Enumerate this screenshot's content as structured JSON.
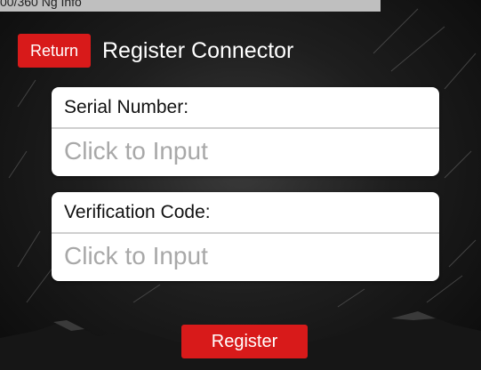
{
  "status_bar": {
    "text": "00/360 Ng Info"
  },
  "header": {
    "return_label": "Return",
    "title": "Register Connector"
  },
  "form": {
    "serial": {
      "label": "Serial Number:",
      "placeholder": "Click to Input",
      "value": ""
    },
    "verification": {
      "label": "Verification Code:",
      "placeholder": "Click to Input",
      "value": ""
    }
  },
  "actions": {
    "register_label": "Register"
  },
  "colors": {
    "accent": "#d81a1a",
    "card": "#ffffff",
    "placeholder": "#a8a8a8"
  }
}
